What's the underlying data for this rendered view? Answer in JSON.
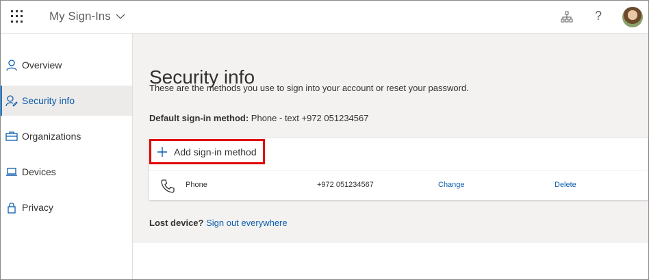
{
  "header": {
    "app_title": "My Sign-Ins",
    "icons": [
      "app-launcher-icon",
      "chevron-down-icon",
      "organization-chart-icon",
      "help-icon",
      "avatar"
    ],
    "help_glyph": "?"
  },
  "sidebar": {
    "items": [
      {
        "label": "Overview",
        "icon": "person-icon",
        "active": false
      },
      {
        "label": "Security info",
        "icon": "person-edit-icon",
        "active": true
      },
      {
        "label": "Organizations",
        "icon": "briefcase-icon",
        "active": false
      },
      {
        "label": "Devices",
        "icon": "laptop-icon",
        "active": false
      },
      {
        "label": "Privacy",
        "icon": "lock-icon",
        "active": false
      }
    ]
  },
  "main": {
    "title": "Security info",
    "subtitle": "These are the methods you use to sign into your account or reset your password.",
    "default_method_label": "Default sign-in method:",
    "default_method_value": "Phone - text +972 051234567",
    "add_method_label": "Add sign-in method",
    "methods": [
      {
        "type": "Phone",
        "value": "+972 051234567",
        "change_label": "Change",
        "delete_label": "Delete",
        "icon": "phone-icon"
      }
    ],
    "lost_device_label": "Lost device?",
    "sign_out_label": "Sign out everywhere"
  },
  "colors": {
    "accent": "#0078d4",
    "link": "#0b5cad",
    "highlight_border": "#e00000",
    "main_background": "#f3f2f1",
    "active_nav_background": "#edebe9"
  }
}
